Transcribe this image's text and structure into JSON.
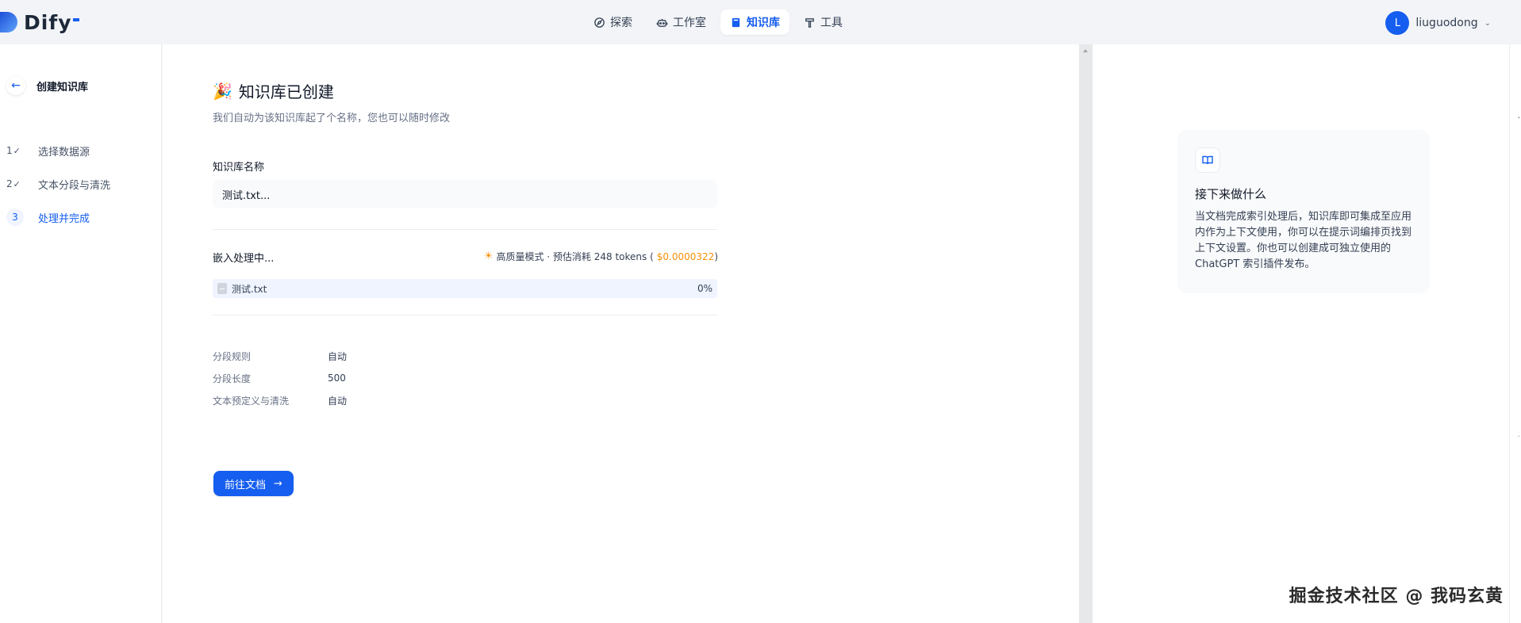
{
  "app": {
    "logo_text": "Dify"
  },
  "nav": [
    {
      "label": "探索",
      "icon": "compass-icon"
    },
    {
      "label": "工作室",
      "icon": "robot-icon"
    },
    {
      "label": "知识库",
      "icon": "book-icon",
      "active": true
    },
    {
      "label": "工具",
      "icon": "hammer-icon"
    }
  ],
  "user": {
    "initial": "L",
    "name": "liuguodong"
  },
  "sidebar": {
    "title": "创建知识库",
    "steps": [
      {
        "num": "1",
        "label": "选择数据源",
        "done": true
      },
      {
        "num": "2",
        "label": "文本分段与清洗",
        "done": true
      },
      {
        "num": "3",
        "label": "处理并完成",
        "current": true
      }
    ]
  },
  "main": {
    "title": "知识库已创建",
    "subtitle": "我们自动为该知识库起了个名称，您也可以随时修改",
    "name_label": "知识库名称",
    "name_value": "测试.txt...",
    "embed_label": "嵌入处理中...",
    "embed_mode": "高质量模式 · 预估消耗 248 tokens (",
    "embed_cost": "$0.0000322",
    "embed_close": ")",
    "file_name": "测试.txt",
    "file_progress": "0%",
    "rules": [
      {
        "key": "分段规则",
        "value": "自动"
      },
      {
        "key": "分段长度",
        "value": "500"
      },
      {
        "key": "文本预定义与清洗",
        "value": "自动"
      }
    ],
    "go_button": "前往文档"
  },
  "tip": {
    "title": "接下来做什么",
    "body": "当文档完成索引处理后，知识库即可集成至应用内作为上下文使用，你可以在提示词编排页找到上下文设置。你也可以创建成可独立使用的 ChatGPT 索引插件发布。"
  },
  "watermark": "掘金技术社区 @ 我码玄黄",
  "colors": {
    "accent": "#155eef",
    "cost": "#f79009"
  }
}
